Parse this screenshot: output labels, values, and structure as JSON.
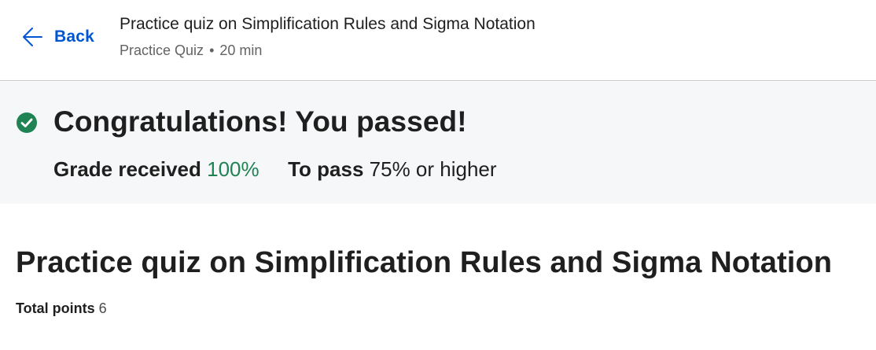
{
  "header": {
    "back_label": "Back",
    "title": "Practice quiz on Simplification Rules and Sigma Notation",
    "item_type": "Practice Quiz",
    "separator": "•",
    "duration": "20 min"
  },
  "result": {
    "message": "Congratulations! You passed!",
    "grade_label": "Grade received",
    "grade_value": "100%",
    "pass_label": "To pass",
    "pass_value": "75% or higher",
    "status_icon": "check-circle-icon"
  },
  "quiz": {
    "title": "Practice quiz on Simplification Rules and Sigma Notation",
    "points_label": "Total points",
    "points_value": "6"
  },
  "colors": {
    "link": "#0056d2",
    "success": "#1f8354",
    "banner_bg": "#f5f7f8"
  }
}
